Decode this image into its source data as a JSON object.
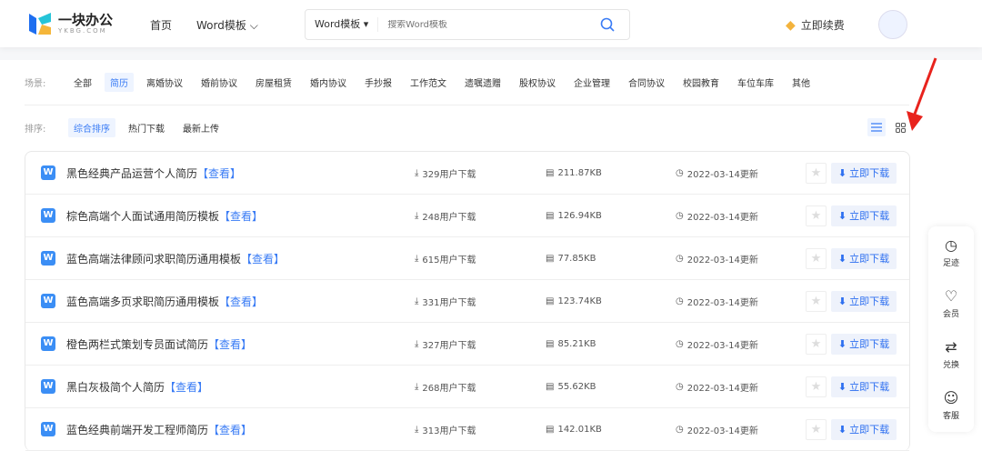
{
  "header": {
    "logo_text": "一块办公",
    "logo_sub": "YKBG.COM",
    "nav": [
      "首页",
      "Word模板"
    ],
    "search_select": "Word模板",
    "search_placeholder": "搜索Word模板",
    "renew": "立即续费"
  },
  "filters": {
    "scene_label": "场景:",
    "scenes": [
      "全部",
      "简历",
      "离婚协议",
      "婚前协议",
      "房屋租赁",
      "婚内协议",
      "手抄报",
      "工作范文",
      "遗嘱遗赠",
      "股权协议",
      "企业管理",
      "合同协议",
      "校园教育",
      "车位车库",
      "其他"
    ],
    "active_scene": "简历",
    "sort_label": "排序:",
    "sorts": [
      "综合排序",
      "热门下载",
      "最新上传"
    ],
    "active_sort": "综合排序"
  },
  "items": [
    {
      "title": "黑色经典产品运营个人简历",
      "view": "【查看】",
      "downloads": "329用户下载",
      "size": "211.87KB",
      "date": "2022-03-14更新"
    },
    {
      "title": "棕色高端个人面试通用简历模板",
      "view": "【查看】",
      "downloads": "248用户下载",
      "size": "126.94KB",
      "date": "2022-03-14更新"
    },
    {
      "title": "蓝色高端法律顾问求职简历通用模板",
      "view": "【查看】",
      "downloads": "615用户下载",
      "size": "77.85KB",
      "date": "2022-03-14更新"
    },
    {
      "title": "蓝色高端多页求职简历通用模板",
      "view": "【查看】",
      "downloads": "331用户下载",
      "size": "123.74KB",
      "date": "2022-03-14更新"
    },
    {
      "title": "橙色两栏式策划专员面试简历",
      "view": "【查看】",
      "downloads": "327用户下载",
      "size": "85.21KB",
      "date": "2022-03-14更新"
    },
    {
      "title": "黑白灰极简个人简历",
      "view": "【查看】",
      "downloads": "268用户下载",
      "size": "55.62KB",
      "date": "2022-03-14更新"
    },
    {
      "title": "蓝色经典前端开发工程师简历",
      "view": "【查看】",
      "downloads": "313用户下载",
      "size": "142.01KB",
      "date": "2022-03-14更新"
    }
  ],
  "download_label": "立即下载",
  "sidebar": [
    "足迹",
    "会员",
    "兑换",
    "客服"
  ],
  "colors": {
    "accent": "#3a7cf5",
    "annotation": "#e8231d"
  }
}
